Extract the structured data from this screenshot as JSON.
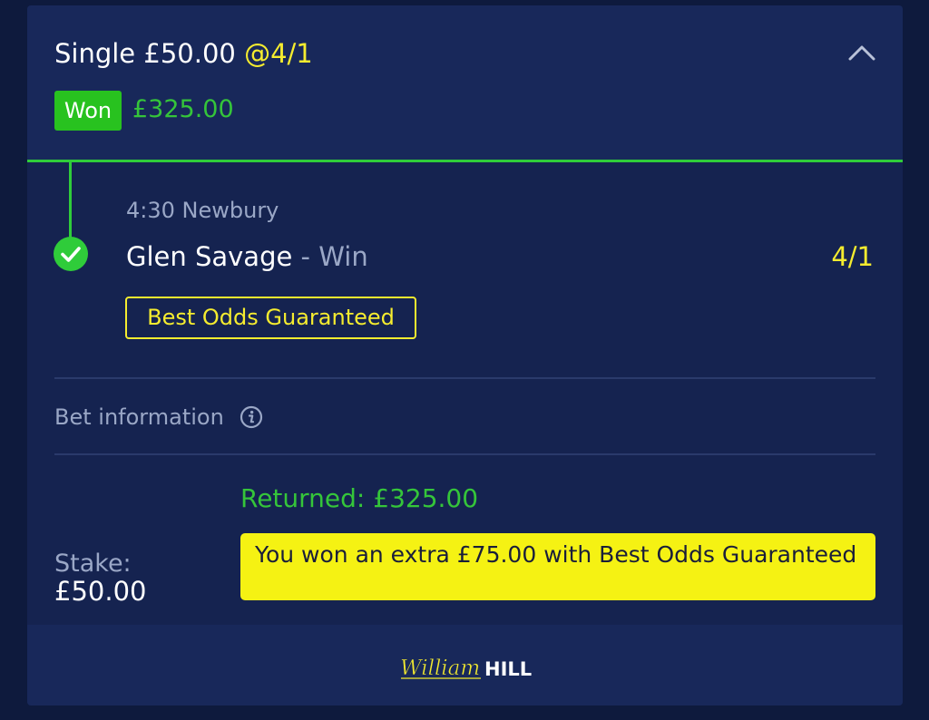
{
  "bet": {
    "title_prefix": "Single £50.00",
    "title_odds": "@4/1",
    "status_badge": "Won",
    "won_amount": "£325.00",
    "collapse_icon": "chevron-up-icon"
  },
  "selection": {
    "event": "4:30 Newbury",
    "runner": "Glen Savage",
    "dash": " - ",
    "market": "Win",
    "odds": "4/1",
    "status_icon": "check-circle-icon",
    "promo_tag": "Best Odds Guaranteed"
  },
  "bet_information": {
    "label": "Bet information",
    "icon": "info-icon"
  },
  "summary": {
    "returned": "Returned: £325.00",
    "stake_label": "Stake:",
    "stake_value": "£50.00",
    "extra_message": "You won an extra £75.00 with Best Odds Guaranteed"
  },
  "footer": {
    "logo_script": "William",
    "logo_block": "HILL"
  },
  "colors": {
    "background": "#0e1a3d",
    "card": "#152350",
    "header": "#18285a",
    "green": "#2fcc3a",
    "yellow": "#f5ec2f",
    "muted": "#9aa7c6"
  }
}
